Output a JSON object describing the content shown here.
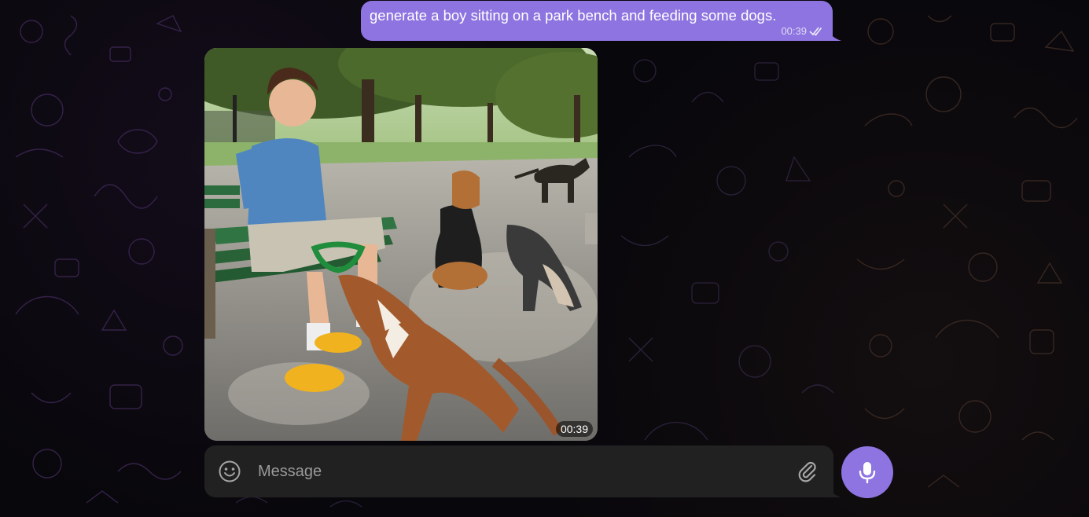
{
  "outgoing_message": {
    "text": "generate a boy sitting on a park bench and feeding some dogs.",
    "time": "00:39",
    "status_icon": "double-check-icon"
  },
  "incoming_image": {
    "time": "00:39"
  },
  "composer": {
    "placeholder": "Message",
    "value": "",
    "emoji_icon": "smile-icon",
    "attach_icon": "paperclip-icon",
    "mic_icon": "microphone-icon"
  },
  "colors": {
    "accent": "#8e74e0",
    "composer_bg": "#212121",
    "background": "#08070b"
  }
}
